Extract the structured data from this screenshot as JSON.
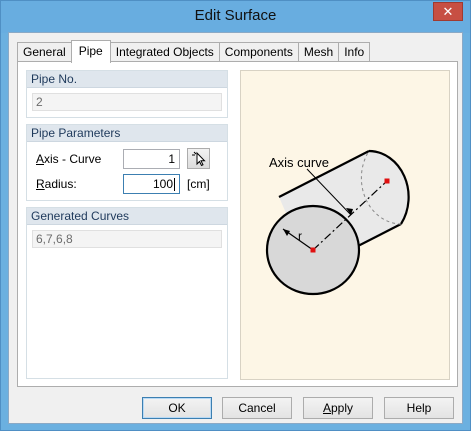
{
  "window": {
    "title": "Edit Surface",
    "close_glyph": "✕"
  },
  "tabs": [
    {
      "label": "General"
    },
    {
      "label": "Pipe",
      "active": true
    },
    {
      "label": "Integrated Objects"
    },
    {
      "label": "Components"
    },
    {
      "label": "Mesh"
    },
    {
      "label": "Info"
    }
  ],
  "pipe_no": {
    "title": "Pipe No.",
    "value": "2"
  },
  "pipe_parameters": {
    "title": "Pipe Parameters",
    "axis_label_prefix": "A",
    "axis_label_rest": "xis - Curve",
    "axis_value": "1",
    "radius_label_prefix": "R",
    "radius_label_rest": "adius:",
    "radius_value": "100",
    "radius_unit": "[cm]"
  },
  "generated_curves": {
    "title": "Generated Curves",
    "value": "6,7,6,8"
  },
  "illustration": {
    "axis_label": "Axis curve",
    "radius_label": "r"
  },
  "buttons": {
    "ok": "OK",
    "cancel": "Cancel",
    "apply_prefix": "A",
    "apply_rest": "pply",
    "help": "Help"
  },
  "colors": {
    "accent": "#3c7fb1",
    "titlebar": "#68ade0",
    "close": "#c74f43",
    "axis_point": "#e01010"
  }
}
